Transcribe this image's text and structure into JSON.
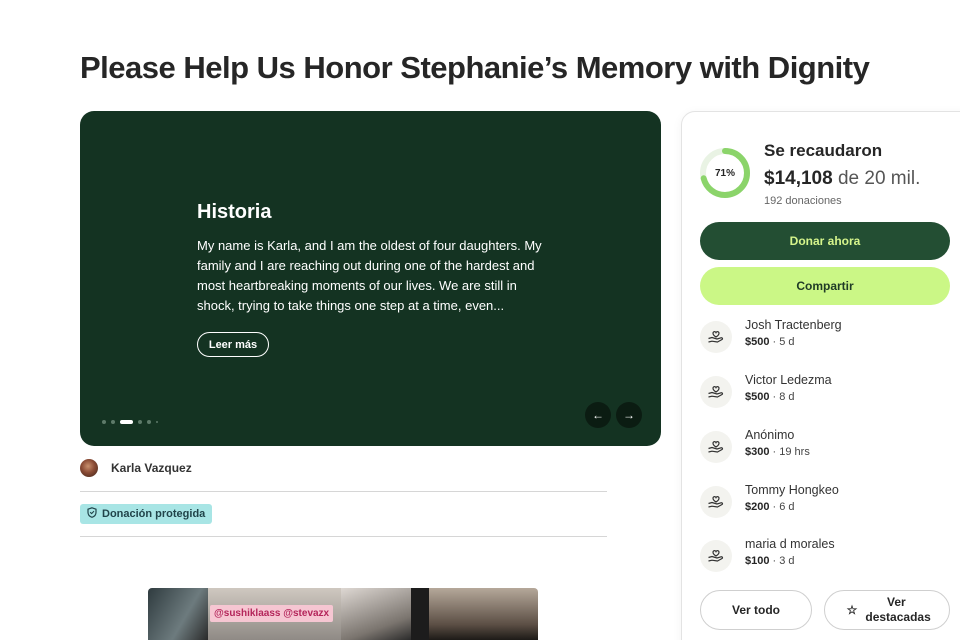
{
  "page": {
    "title": "Please Help Us Honor Stephanie’s Memory with Dignity"
  },
  "story": {
    "heading": "Historia",
    "text": "My name is Karla, and I am the oldest of four daughters. My family and I are reaching out during one of the hardest and most heartbreaking moments of our lives. We are still in shock, trying to take things one step at a time, even...",
    "read_more": "Leer más",
    "background_color": "#143322",
    "slide_count": 6,
    "active_slide": 3
  },
  "organizer": {
    "name": "Karla Vazquez"
  },
  "badge": {
    "label": "Donación protegida",
    "icon": "shield-icon",
    "color": "#a8e5e5"
  },
  "photos": {
    "tag": "@sushiklaass @stevazx"
  },
  "fundraiser": {
    "progress_percent": 71,
    "progress_label": "71%",
    "raised_label": "Se recaudaron",
    "amount": "$14,108",
    "goal": "de 20 mil.",
    "donations_count": "192 donaciones",
    "accent_color": "#8bd46a"
  },
  "actions": {
    "donate": "Donar ahora",
    "share": "Compartir",
    "see_all": "Ver todo",
    "see_top": "Ver destacadas",
    "donate_color": "#234e33",
    "share_color": "#cbf786"
  },
  "donors": [
    {
      "name": "Josh Tractenberg",
      "amount": "$500",
      "time": " · 5 d"
    },
    {
      "name": "Victor Ledezma",
      "amount": "$500",
      "time": " · 8 d"
    },
    {
      "name": "Anónimo",
      "amount": "$300",
      "time": " · 19 hrs"
    },
    {
      "name": "Tommy Hongkeo",
      "amount": "$200",
      "time": " · 6 d"
    },
    {
      "name": "maria d morales",
      "amount": "$100",
      "time": " · 3 d"
    }
  ]
}
